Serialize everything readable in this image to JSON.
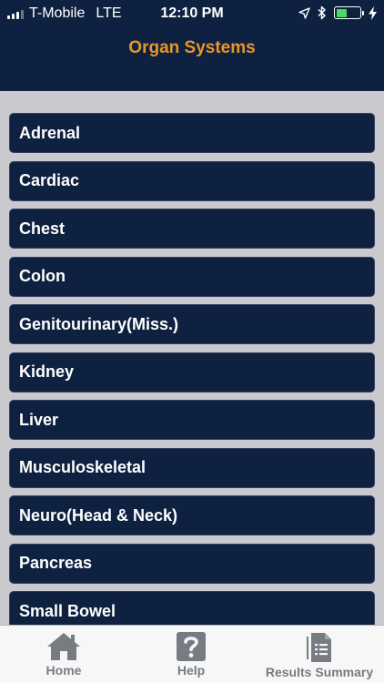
{
  "status_bar": {
    "carrier": "T-Mobile",
    "network": "LTE",
    "time": "12:10 PM",
    "battery_level": 0.45,
    "icons": [
      "location-arrow-icon",
      "bluetooth-icon",
      "battery-icon",
      "charging-bolt-icon"
    ]
  },
  "header": {
    "title": "Organ Systems"
  },
  "organ_list": [
    {
      "label": "Adrenal"
    },
    {
      "label": "Cardiac"
    },
    {
      "label": "Chest"
    },
    {
      "label": "Colon"
    },
    {
      "label": "Genitourinary(Miss.)"
    },
    {
      "label": "Kidney"
    },
    {
      "label": "Liver"
    },
    {
      "label": "Musculoskeletal"
    },
    {
      "label": "Neuro(Head & Neck)"
    },
    {
      "label": "Pancreas"
    },
    {
      "label": "Small Bowel"
    }
  ],
  "tab_bar": {
    "home": {
      "label": "Home",
      "icon": "house-icon"
    },
    "help": {
      "label": "Help",
      "icon": "question-mark-icon"
    },
    "results": {
      "label": "Results Summary",
      "icon": "document-icon"
    }
  },
  "colors": {
    "header_bg": "#0e2140",
    "title": "#e8952a",
    "list_bg": "#c9c9ce",
    "tab_gray": "#777b82"
  }
}
